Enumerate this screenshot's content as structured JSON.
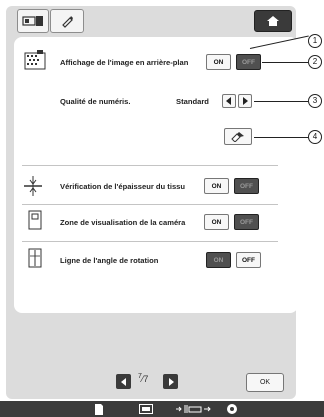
{
  "toolbar": {
    "left_icon": "camera-scan-icon",
    "mid_icon": "pen-icon",
    "home_icon": "home-icon"
  },
  "rows": [
    {
      "label": "Affichage de l'image en arrière-plan",
      "on": "ON",
      "off": "OFF",
      "selected": "OFF",
      "icon": "background-image-icon"
    },
    {
      "label": "Qualité de numéris.",
      "value": "Standard",
      "icon": ""
    },
    {
      "label": "",
      "icon": "eraser-icon"
    },
    {
      "label": "Vérification de l'épaisseur du tissu",
      "on": "ON",
      "off": "OFF",
      "selected": "OFF",
      "icon": "fabric-thickness-icon"
    },
    {
      "label": "Zone de visualisation de la caméra",
      "on": "ON",
      "off": "OFF",
      "selected": "OFF",
      "icon": "camera-view-icon"
    },
    {
      "label": "Ligne de l'angle de rotation",
      "on": "ON",
      "off": "OFF",
      "selected": "ON",
      "icon": "rotation-line-icon"
    }
  ],
  "callouts": [
    "1",
    "2",
    "3",
    "4"
  ],
  "pager": {
    "current": "7",
    "total": "7"
  },
  "ok_label": "OK",
  "bottom_icons": [
    "document-icon",
    "frame-icon",
    "needle-position-icon",
    "bobbin-icon"
  ],
  "colors": {
    "panel": "#ffffff",
    "frame": "#dcdcdc",
    "dark_button": "#505050"
  }
}
